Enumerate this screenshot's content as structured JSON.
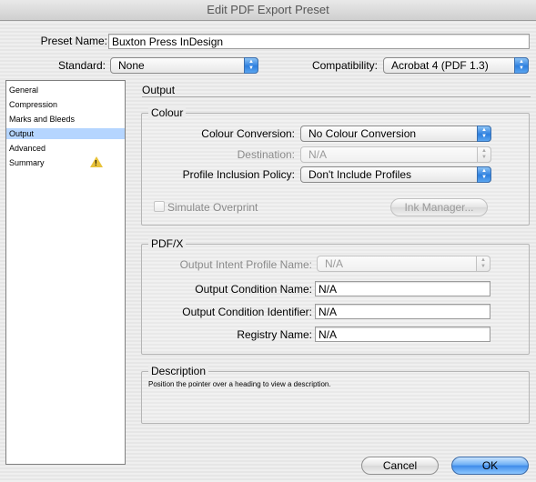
{
  "window": {
    "title": "Edit PDF Export Preset"
  },
  "preset": {
    "label": "Preset Name:",
    "value": "Buxton Press InDesign"
  },
  "standard": {
    "label": "Standard:",
    "value": "None"
  },
  "compatibility": {
    "label": "Compatibility:",
    "value": "Acrobat 4 (PDF 1.3)"
  },
  "sidebar": {
    "items": [
      {
        "label": "General"
      },
      {
        "label": "Compression"
      },
      {
        "label": "Marks and Bleeds"
      },
      {
        "label": "Output"
      },
      {
        "label": "Advanced"
      },
      {
        "label": "Summary"
      }
    ],
    "selected": "Output"
  },
  "section": {
    "title": "Output"
  },
  "colour": {
    "title": "Colour",
    "conversion_label": "Colour Conversion:",
    "conversion_value": "No Colour Conversion",
    "destination_label": "Destination:",
    "destination_value": "N/A",
    "profile_label": "Profile Inclusion Policy:",
    "profile_value": "Don't Include Profiles",
    "simulate_label": "Simulate Overprint",
    "ink_manager_label": "Ink Manager..."
  },
  "pdfx": {
    "title": "PDF/X",
    "intent_label": "Output Intent Profile Name:",
    "intent_value": "N/A",
    "condition_name_label": "Output Condition Name:",
    "condition_name_value": "N/A",
    "condition_id_label": "Output Condition Identifier:",
    "condition_id_value": "N/A",
    "registry_label": "Registry Name:",
    "registry_value": "N/A"
  },
  "description": {
    "title": "Description",
    "text": "Position the pointer over a heading to view a description."
  },
  "buttons": {
    "cancel": "Cancel",
    "ok": "OK"
  },
  "icons": {
    "warning": "warning-icon",
    "popup": "popup-arrows-icon"
  },
  "colors": {
    "accent": "#3f8cea",
    "selection": "#b5d5ff",
    "warning": "#e8c23a"
  }
}
